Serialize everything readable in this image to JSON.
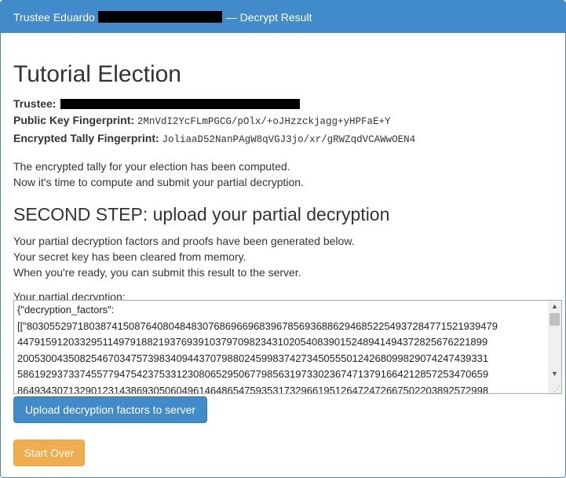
{
  "window": {
    "trustee_prefix": "Trustee Eduardo",
    "title_suffix": "— Decrypt Result"
  },
  "main": {
    "title": "Tutorial Election",
    "trustee_label": "Trustee:",
    "pk_label": "Public Key Fingerprint:",
    "pk_value": "2MnVdI2YcFLmPGCG/pOlx/+oJHzzckjagg+yHPFaE+Y",
    "tally_label": "Encrypted Tally Fingerprint:",
    "tally_value": "JoliaaD52NanPAgW8qVGJ3jo/xr/gRWZqdVCAWwOEN4",
    "intro_line1": "The encrypted tally for your election has been computed.",
    "intro_line2": "Now it's time to compute and submit your partial decryption.",
    "step_heading": "SECOND STEP: upload your partial decryption",
    "step_line1": "Your partial decryption factors and proofs have been generated below.",
    "step_line2": "Your secret key has been cleared from memory.",
    "step_line3": "When you're ready, you can submit this result to the server.",
    "textarea_label": "Your partial decryption:",
    "textarea_value": "{\"decryption_factors\":\n[[\"80305529718038741508764080484830768696696839678569368862946852254937284771521939479\n44791591203329511497918821937693910379709823431020540839015248941494372825676221899\n20053004350825467034757398340944370798802459983742734505550124268099829074247439331\n58619293733745577947542375331230806529506779856319733023674713791664212857253470659\n86493430713290123143869305060496146486547593531732966195126472472667502203892572998"
  },
  "buttons": {
    "upload": "Upload decryption factors to server",
    "start_over": "Start Over"
  },
  "colors": {
    "primary": "#428bca",
    "warning": "#f0ad4e"
  }
}
